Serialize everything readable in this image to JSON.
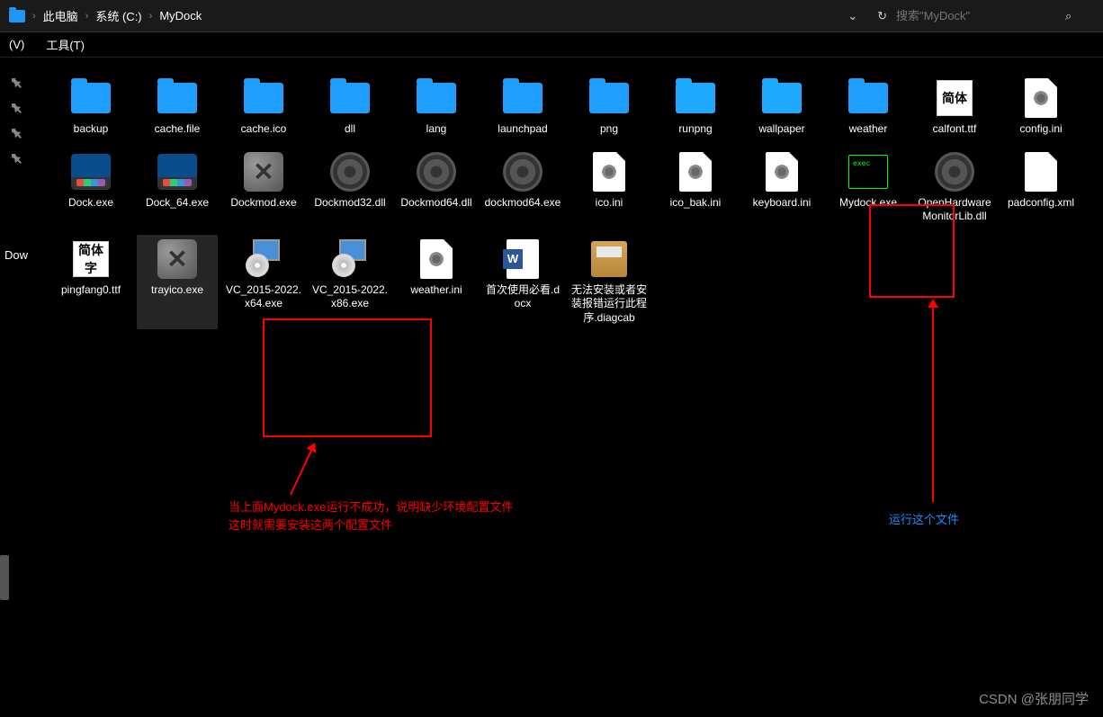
{
  "breadcrumb": {
    "items": [
      "此电脑",
      "系统 (C:)",
      "MyDock"
    ]
  },
  "search": {
    "placeholder": "搜索\"MyDock\""
  },
  "menu": {
    "item1": "(V)",
    "item2": "工具(T)"
  },
  "sidebar_label": "Dow",
  "files": {
    "row1": [
      {
        "name": "backup",
        "type": "folder"
      },
      {
        "name": "cache.file",
        "type": "folder"
      },
      {
        "name": "cache.ico",
        "type": "folder"
      },
      {
        "name": "dll",
        "type": "folder"
      },
      {
        "name": "lang",
        "type": "folder"
      },
      {
        "name": "launchpad",
        "type": "folder"
      },
      {
        "name": "png",
        "type": "folder"
      },
      {
        "name": "runpng",
        "type": "folder-light"
      },
      {
        "name": "wallpaper",
        "type": "folder-light"
      },
      {
        "name": "weather",
        "type": "folder"
      },
      {
        "name": "calfont.ttf",
        "type": "ttf",
        "ttf_text": "简体"
      },
      {
        "name": "config.ini",
        "type": "gear-file"
      }
    ],
    "row2": [
      {
        "name": "Dock.exe",
        "type": "dock-exe"
      },
      {
        "name": "Dock_64.exe",
        "type": "dock-exe"
      },
      {
        "name": "Dockmod.exe",
        "type": "tool-exe"
      },
      {
        "name": "Dockmod32.dll",
        "type": "dll-gear"
      },
      {
        "name": "Dockmod64.dll",
        "type": "dll-gear"
      },
      {
        "name": "dockmod64.exe",
        "type": "dll-gear"
      },
      {
        "name": "ico.ini",
        "type": "gear-file"
      },
      {
        "name": "ico_bak.ini",
        "type": "gear-file"
      },
      {
        "name": "keyboard.ini",
        "type": "gear-file"
      },
      {
        "name": "Mydock.exe",
        "type": "exec-black",
        "exec_text": "exec"
      },
      {
        "name": "OpenHardwareMonitorLib.dll",
        "type": "dll-gear"
      },
      {
        "name": "padconfig.xml",
        "type": "blank-file"
      }
    ],
    "row3": [
      {
        "name": "pingfang0.ttf",
        "type": "ttf",
        "ttf_text": "简体字"
      },
      {
        "name": "trayico.exe",
        "type": "tool-exe",
        "selected": true
      },
      {
        "name": "VC_2015-2022.x64.exe",
        "type": "installer"
      },
      {
        "name": "VC_2015-2022.x86.exe",
        "type": "installer"
      },
      {
        "name": "weather.ini",
        "type": "gear-file"
      },
      {
        "name": "首次使用必看.docx",
        "type": "word"
      },
      {
        "name": "无法安装或者安装报错运行此程序.diagcab",
        "type": "diagcab"
      }
    ]
  },
  "annotations": {
    "red_text_line1": "当上面Mydock.exe运行不成功，说明缺少环境配置文件",
    "red_text_line2": "这时就需要安装这两个配置文件",
    "blue_text": "运行这个文件"
  },
  "watermark": "CSDN @张朋同学"
}
